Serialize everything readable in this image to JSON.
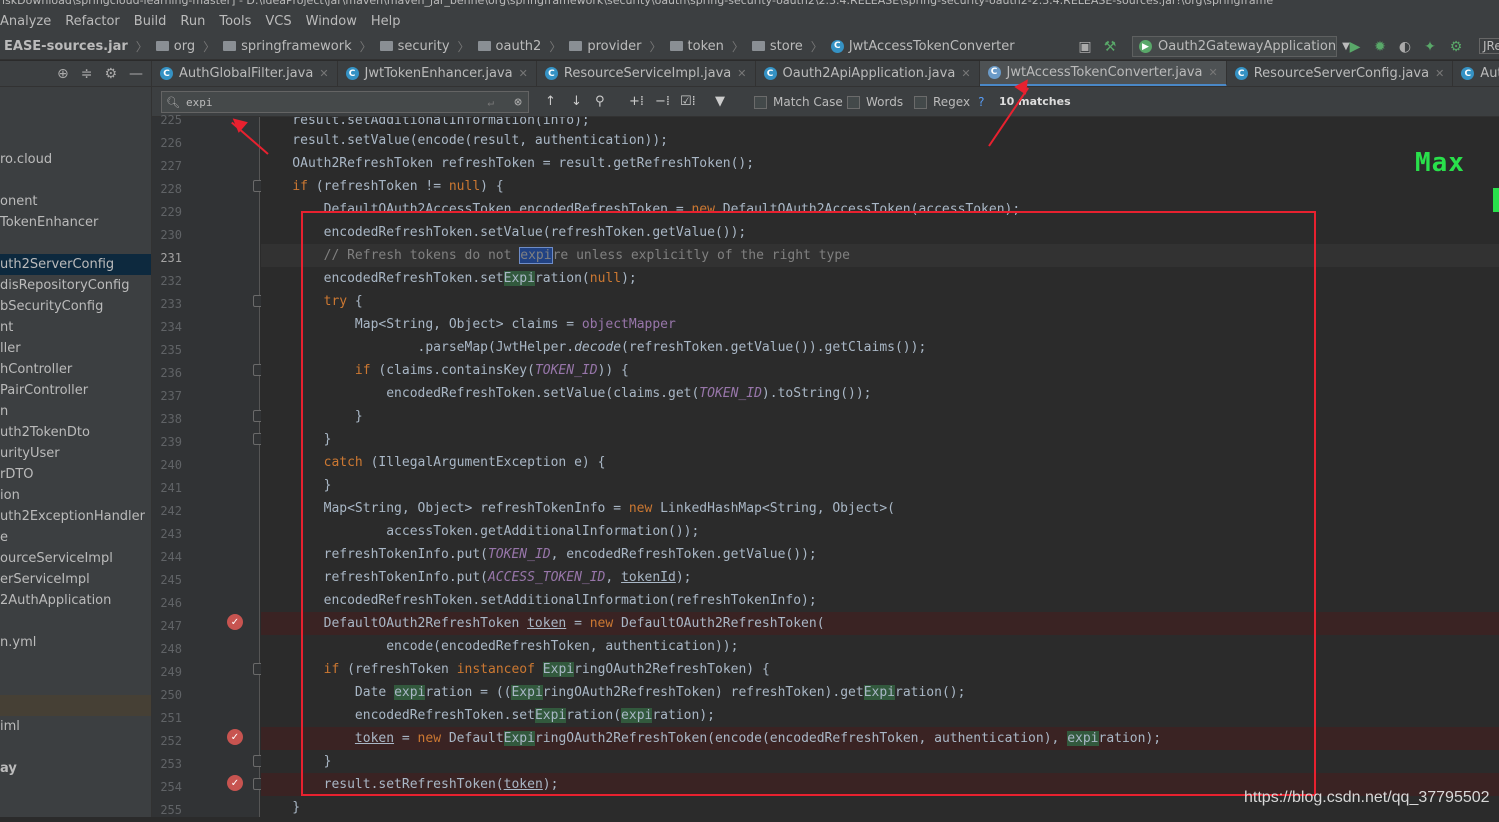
{
  "title_bar": {
    "text": "iskDownload\\springcloud-learning-master] - D:\\IdeaProject\\jar\\maven\\maven_jar_benhe\\org\\springframework\\security\\oauth\\spring-security-oauth2\\2.3.4.RELEASE\\spring-security-oauth2-2.3.4.RELEASE-sources.jar!\\org\\springframe"
  },
  "menu": [
    "Analyze",
    "Refactor",
    "Build",
    "Run",
    "Tools",
    "VCS",
    "Window",
    "Help"
  ],
  "breadcrumbs": [
    "EASE-sources.jar",
    "org",
    "springframework",
    "security",
    "oauth2",
    "provider",
    "token",
    "store",
    "JwtAccessTokenConverter"
  ],
  "run_config": "Oauth2GatewayApplication",
  "jre_label": "JRe",
  "sidebar": {
    "items": [
      {
        "label": "ro.cloud"
      },
      {
        "label": "onent"
      },
      {
        "label": "TokenEnhancer"
      },
      {
        "label": "uth2ServerConfig"
      },
      {
        "label": "disRepositoryConfig"
      },
      {
        "label": "bSecurityConfig"
      },
      {
        "label": "nt"
      },
      {
        "label": "ller"
      },
      {
        "label": "hController"
      },
      {
        "label": "PairController"
      },
      {
        "label": "n"
      },
      {
        "label": "uth2TokenDto"
      },
      {
        "label": "urityUser"
      },
      {
        "label": "rDTO"
      },
      {
        "label": "ion"
      },
      {
        "label": "uth2ExceptionHandler"
      },
      {
        "label": "e"
      },
      {
        "label": "ourceServiceImpl"
      },
      {
        "label": "erServiceImpl"
      },
      {
        "label": "2AuthApplication"
      },
      {
        "label": "n.yml"
      },
      {
        "label": ""
      },
      {
        "label": "iml"
      },
      {
        "label": "ay"
      }
    ]
  },
  "tabs": [
    {
      "label": "AuthGlobalFilter.java"
    },
    {
      "label": "JwtTokenEnhancer.java"
    },
    {
      "label": "ResourceServiceImpl.java"
    },
    {
      "label": "Oauth2ApiApplication.java"
    },
    {
      "label": "JwtAccessTokenConverter.java"
    },
    {
      "label": "ResourceServerConfig.java"
    },
    {
      "label": "AuthController.java"
    }
  ],
  "find": {
    "query": "expi",
    "match_case": "Match Case",
    "words": "Words",
    "regex": "Regex",
    "regex_help": "?",
    "matches": "10 matches"
  },
  "line_numbers": [
    "225",
    "226",
    "227",
    "228",
    "229",
    "230",
    "231",
    "232",
    "233",
    "234",
    "235",
    "236",
    "237",
    "238",
    "239",
    "240",
    "241",
    "242",
    "243",
    "244",
    "245",
    "246",
    "247",
    "248",
    "249",
    "250",
    "251",
    "252",
    "253",
    "254",
    "255"
  ],
  "overlay_text": "Max",
  "watermark": "https://blog.csdn.net/qq_37795502",
  "colors": {
    "annotation_red": "#e8212f",
    "overlay_green": "#29e04b",
    "match_bg": "#32593d"
  }
}
